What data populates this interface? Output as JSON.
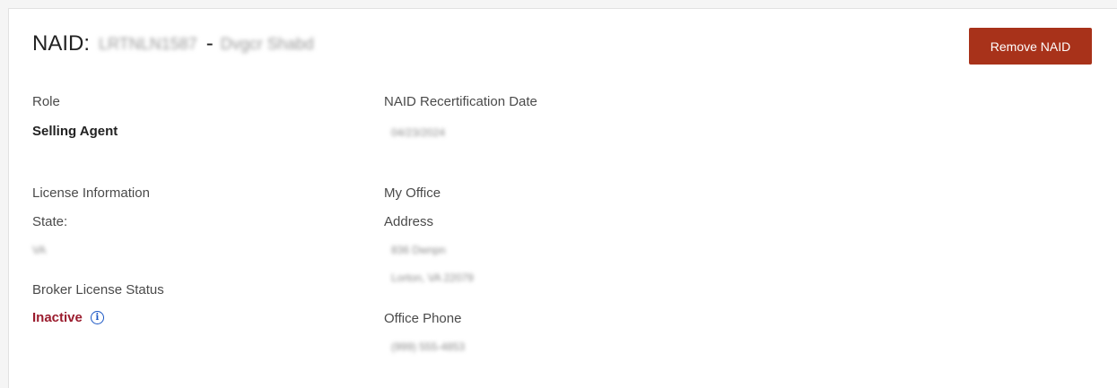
{
  "header": {
    "prefix": "NAID:",
    "naid_id": "LRTNLN1587",
    "separator": "-",
    "naid_name": "Dvgcr Shabd"
  },
  "remove_button": {
    "label": "Remove NAID"
  },
  "left": {
    "role_label": "Role",
    "role_value": "Selling Agent",
    "license_label": "License Information",
    "state_label": "State:",
    "state_value": "VA",
    "broker_status_label": "Broker License Status",
    "broker_status_value": "Inactive",
    "info_icon_glyph": "i"
  },
  "right": {
    "recert_label": "NAID Recertification Date",
    "recert_value": "04/23/2024",
    "office_label": "My Office",
    "address_label": "Address",
    "address_line1": "836 Dwnpn",
    "address_line2": "Lorton, VA 22079",
    "phone_label": "Office Phone",
    "phone_value": "(999) 555-4853"
  },
  "colors": {
    "button_bg": "#a8321a",
    "inactive": "#9b1c2e",
    "info_icon": "#1a56c4"
  },
  "icons": {
    "info": "info-circle-icon"
  }
}
